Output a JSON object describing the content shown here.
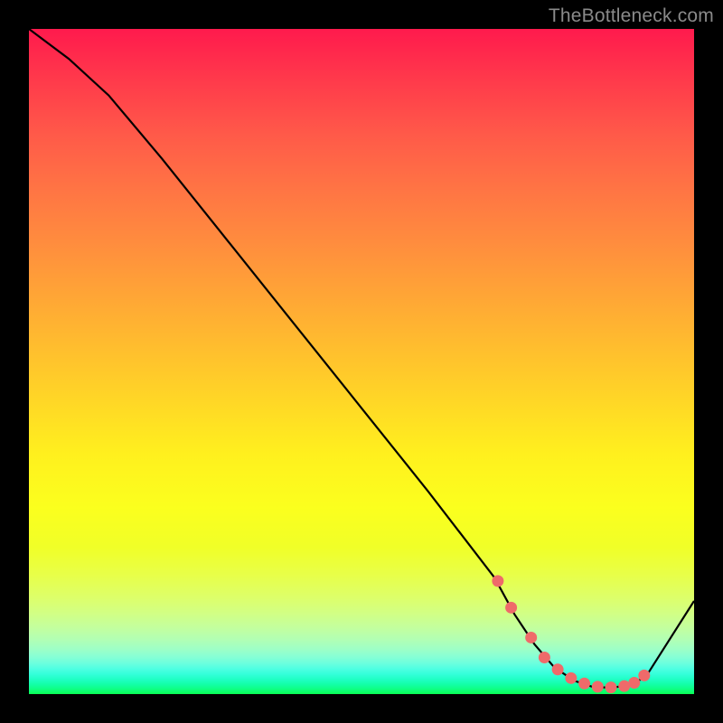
{
  "watermark": "TheBottleneck.com",
  "colors": {
    "line": "#000000",
    "marker_fill": "#ef6a6a",
    "marker_stroke": "#d84e4e"
  },
  "chart_data": {
    "type": "line",
    "title": "",
    "xlabel": "",
    "ylabel": "",
    "xlim": [
      0,
      100
    ],
    "ylim": [
      0,
      100
    ],
    "series": [
      {
        "name": "curve",
        "x": [
          0,
          6,
          12,
          20,
          30,
          40,
          50,
          60,
          70,
          73,
          76,
          79,
          82,
          85,
          88,
          91,
          93,
          100
        ],
        "y": [
          100,
          95.5,
          90,
          80.5,
          68,
          55.5,
          43,
          30.5,
          17.5,
          12,
          7.5,
          4,
          2,
          1,
          1,
          1.5,
          3,
          14
        ]
      }
    ],
    "markers": {
      "name": "highlight-points",
      "x": [
        70.5,
        72.5,
        75.5,
        77.5,
        79.5,
        81.5,
        83.5,
        85.5,
        87.5,
        89.5,
        91,
        92.5
      ],
      "y": [
        17,
        13,
        8.5,
        5.5,
        3.7,
        2.4,
        1.6,
        1.1,
        1,
        1.2,
        1.7,
        2.8
      ]
    }
  }
}
